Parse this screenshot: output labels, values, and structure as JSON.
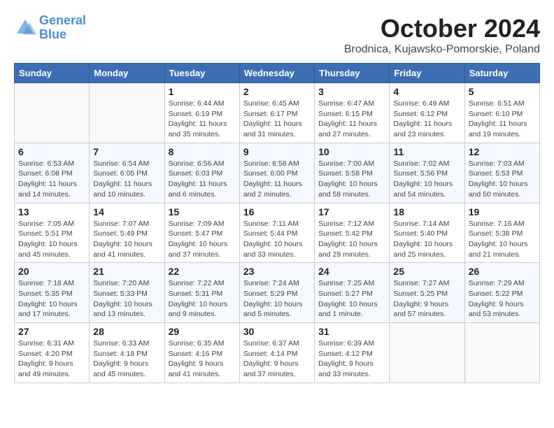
{
  "header": {
    "logo_line1": "General",
    "logo_line2": "Blue",
    "month": "October 2024",
    "location": "Brodnica, Kujawsko-Pomorskie, Poland"
  },
  "weekdays": [
    "Sunday",
    "Monday",
    "Tuesday",
    "Wednesday",
    "Thursday",
    "Friday",
    "Saturday"
  ],
  "weeks": [
    [
      {
        "day": "",
        "info": ""
      },
      {
        "day": "",
        "info": ""
      },
      {
        "day": "1",
        "info": "Sunrise: 6:44 AM\nSunset: 6:19 PM\nDaylight: 11 hours and 35 minutes."
      },
      {
        "day": "2",
        "info": "Sunrise: 6:45 AM\nSunset: 6:17 PM\nDaylight: 11 hours and 31 minutes."
      },
      {
        "day": "3",
        "info": "Sunrise: 6:47 AM\nSunset: 6:15 PM\nDaylight: 11 hours and 27 minutes."
      },
      {
        "day": "4",
        "info": "Sunrise: 6:49 AM\nSunset: 6:12 PM\nDaylight: 11 hours and 23 minutes."
      },
      {
        "day": "5",
        "info": "Sunrise: 6:51 AM\nSunset: 6:10 PM\nDaylight: 11 hours and 19 minutes."
      }
    ],
    [
      {
        "day": "6",
        "info": "Sunrise: 6:53 AM\nSunset: 6:08 PM\nDaylight: 11 hours and 14 minutes."
      },
      {
        "day": "7",
        "info": "Sunrise: 6:54 AM\nSunset: 6:05 PM\nDaylight: 11 hours and 10 minutes."
      },
      {
        "day": "8",
        "info": "Sunrise: 6:56 AM\nSunset: 6:03 PM\nDaylight: 11 hours and 6 minutes."
      },
      {
        "day": "9",
        "info": "Sunrise: 6:58 AM\nSunset: 6:00 PM\nDaylight: 11 hours and 2 minutes."
      },
      {
        "day": "10",
        "info": "Sunrise: 7:00 AM\nSunset: 5:58 PM\nDaylight: 10 hours and 58 minutes."
      },
      {
        "day": "11",
        "info": "Sunrise: 7:02 AM\nSunset: 5:56 PM\nDaylight: 10 hours and 54 minutes."
      },
      {
        "day": "12",
        "info": "Sunrise: 7:03 AM\nSunset: 5:53 PM\nDaylight: 10 hours and 50 minutes."
      }
    ],
    [
      {
        "day": "13",
        "info": "Sunrise: 7:05 AM\nSunset: 5:51 PM\nDaylight: 10 hours and 45 minutes."
      },
      {
        "day": "14",
        "info": "Sunrise: 7:07 AM\nSunset: 5:49 PM\nDaylight: 10 hours and 41 minutes."
      },
      {
        "day": "15",
        "info": "Sunrise: 7:09 AM\nSunset: 5:47 PM\nDaylight: 10 hours and 37 minutes."
      },
      {
        "day": "16",
        "info": "Sunrise: 7:11 AM\nSunset: 5:44 PM\nDaylight: 10 hours and 33 minutes."
      },
      {
        "day": "17",
        "info": "Sunrise: 7:12 AM\nSunset: 5:42 PM\nDaylight: 10 hours and 29 minutes."
      },
      {
        "day": "18",
        "info": "Sunrise: 7:14 AM\nSunset: 5:40 PM\nDaylight: 10 hours and 25 minutes."
      },
      {
        "day": "19",
        "info": "Sunrise: 7:16 AM\nSunset: 5:38 PM\nDaylight: 10 hours and 21 minutes."
      }
    ],
    [
      {
        "day": "20",
        "info": "Sunrise: 7:18 AM\nSunset: 5:35 PM\nDaylight: 10 hours and 17 minutes."
      },
      {
        "day": "21",
        "info": "Sunrise: 7:20 AM\nSunset: 5:33 PM\nDaylight: 10 hours and 13 minutes."
      },
      {
        "day": "22",
        "info": "Sunrise: 7:22 AM\nSunset: 5:31 PM\nDaylight: 10 hours and 9 minutes."
      },
      {
        "day": "23",
        "info": "Sunrise: 7:24 AM\nSunset: 5:29 PM\nDaylight: 10 hours and 5 minutes."
      },
      {
        "day": "24",
        "info": "Sunrise: 7:25 AM\nSunset: 5:27 PM\nDaylight: 10 hours and 1 minute."
      },
      {
        "day": "25",
        "info": "Sunrise: 7:27 AM\nSunset: 5:25 PM\nDaylight: 9 hours and 57 minutes."
      },
      {
        "day": "26",
        "info": "Sunrise: 7:29 AM\nSunset: 5:22 PM\nDaylight: 9 hours and 53 minutes."
      }
    ],
    [
      {
        "day": "27",
        "info": "Sunrise: 6:31 AM\nSunset: 4:20 PM\nDaylight: 9 hours and 49 minutes."
      },
      {
        "day": "28",
        "info": "Sunrise: 6:33 AM\nSunset: 4:18 PM\nDaylight: 9 hours and 45 minutes."
      },
      {
        "day": "29",
        "info": "Sunrise: 6:35 AM\nSunset: 4:16 PM\nDaylight: 9 hours and 41 minutes."
      },
      {
        "day": "30",
        "info": "Sunrise: 6:37 AM\nSunset: 4:14 PM\nDaylight: 9 hours and 37 minutes."
      },
      {
        "day": "31",
        "info": "Sunrise: 6:39 AM\nSunset: 4:12 PM\nDaylight: 9 hours and 33 minutes."
      },
      {
        "day": "",
        "info": ""
      },
      {
        "day": "",
        "info": ""
      }
    ]
  ]
}
